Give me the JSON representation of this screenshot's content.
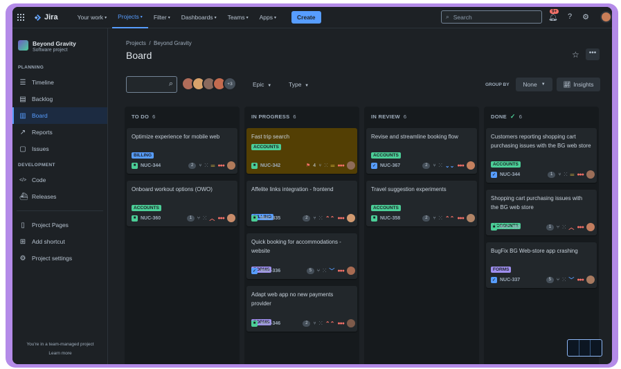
{
  "topbar": {
    "app_name": "Jira",
    "nav": [
      {
        "label": "Your work",
        "active": false
      },
      {
        "label": "Projects",
        "active": true
      },
      {
        "label": "Filter",
        "active": false
      },
      {
        "label": "Dashboards",
        "active": false
      },
      {
        "label": "Teams",
        "active": false
      },
      {
        "label": "Apps",
        "active": false
      }
    ],
    "create_label": "Create",
    "search_placeholder": "Search",
    "notification_badge": "9+",
    "brand_color": "#579dff"
  },
  "sidebar": {
    "project_name": "Beyond Gravity",
    "project_type": "Software project",
    "planning_label": "PLANNING",
    "planning_items": [
      {
        "label": "Timeline",
        "icon": "timeline-icon",
        "active": false
      },
      {
        "label": "Backlog",
        "icon": "backlog-icon",
        "active": false
      },
      {
        "label": "Board",
        "icon": "board-icon",
        "active": true
      },
      {
        "label": "Reports",
        "icon": "reports-icon",
        "active": false
      },
      {
        "label": "Issues",
        "icon": "issues-icon",
        "active": false
      }
    ],
    "development_label": "DEVELOPMENT",
    "development_items": [
      {
        "label": "Code",
        "icon": "code-icon"
      },
      {
        "label": "Releases",
        "icon": "releases-icon"
      }
    ],
    "other_items": [
      {
        "label": "Project Pages",
        "icon": "pages-icon"
      },
      {
        "label": "Add shortcut",
        "icon": "add-shortcut-icon"
      },
      {
        "label": "Project settings",
        "icon": "settings-icon"
      }
    ],
    "footer_text": "You're in a team-managed project",
    "footer_link": "Learn more"
  },
  "main": {
    "breadcrumb": [
      "Projects",
      "Beyond Gravity"
    ],
    "title": "Board",
    "avatar_more": "+3",
    "filters": [
      "Epic",
      "Type"
    ],
    "group_by_label": "GROUP BY",
    "group_by_value": "None",
    "insights_label": "Insights"
  },
  "columns": [
    {
      "name": "TO DO",
      "count": "6",
      "done": false,
      "cards": [
        {
          "title": "Optimize experience for mobile web",
          "label": "BILLING",
          "label_color": "blue",
          "type": "story",
          "key": "NUC-344",
          "points": "2",
          "priority": "medium",
          "highlight": false
        },
        {
          "title": "Onboard workout options (OWO)",
          "label": "ACCOUNTS",
          "label_color": "green",
          "type": "story",
          "key": "NUC-360",
          "points": "1",
          "priority": "high",
          "highlight": false
        }
      ]
    },
    {
      "name": "IN PROGRESS",
      "count": "6",
      "done": false,
      "cards": [
        {
          "title": "Fast trip search",
          "label": "ACCOUNTS",
          "label_color": "green",
          "type": "story",
          "key": "NUC-342",
          "points": "4",
          "priority": "medium",
          "highlight": true,
          "flag": true
        },
        {
          "title": "Affelite links integration - frontend",
          "label": "BILLING",
          "label_color": "blue",
          "type": "story",
          "key": "NUC-335",
          "points": "2",
          "priority": "highest",
          "highlight": false
        },
        {
          "title": "Quick booking for accommodations - website",
          "label": "FORMS",
          "label_color": "purple",
          "type": "task",
          "key": "NUC-336",
          "points": "5",
          "priority": "low",
          "highlight": false
        },
        {
          "title": "Adapt web app no new payments provider",
          "label": "FORMS",
          "label_color": "purple",
          "type": "story",
          "key": "NUC-346",
          "points": "2",
          "priority": "highest",
          "highlight": false
        }
      ]
    },
    {
      "name": "IN REVIEW",
      "count": "6",
      "done": false,
      "cards": [
        {
          "title": "Revise and streamline booking flow",
          "label": "ACCOUNTS",
          "label_color": "green",
          "type": "task",
          "key": "NUC-367",
          "points": "2",
          "priority": "lowest",
          "highlight": false
        },
        {
          "title": "Travel suggestion experiments",
          "label": "ACCOUNTS",
          "label_color": "green",
          "type": "story",
          "key": "NUC-358",
          "points": "2",
          "priority": "highest",
          "highlight": false
        }
      ]
    },
    {
      "name": "DONE",
      "count": "6",
      "done": true,
      "cards": [
        {
          "title": "Customers reporting shopping cart purchasing issues with the BG web store",
          "label": "ACCOUNTS",
          "label_color": "green",
          "type": "task",
          "key": "NUC-344",
          "points": "1",
          "priority": "medium",
          "highlight": false
        },
        {
          "title": "Shopping cart purchasing issues with the BG web store",
          "label": "ACCOUNTS",
          "label_color": "green",
          "type": "story",
          "key": "NUC-360",
          "points": "1",
          "priority": "high",
          "highlight": false
        },
        {
          "title": "BugFix BG Web-store app crashing",
          "label": "FORMS",
          "label_color": "purple",
          "type": "task",
          "key": "NUC-337",
          "points": "5",
          "priority": "low",
          "highlight": false
        }
      ]
    }
  ]
}
